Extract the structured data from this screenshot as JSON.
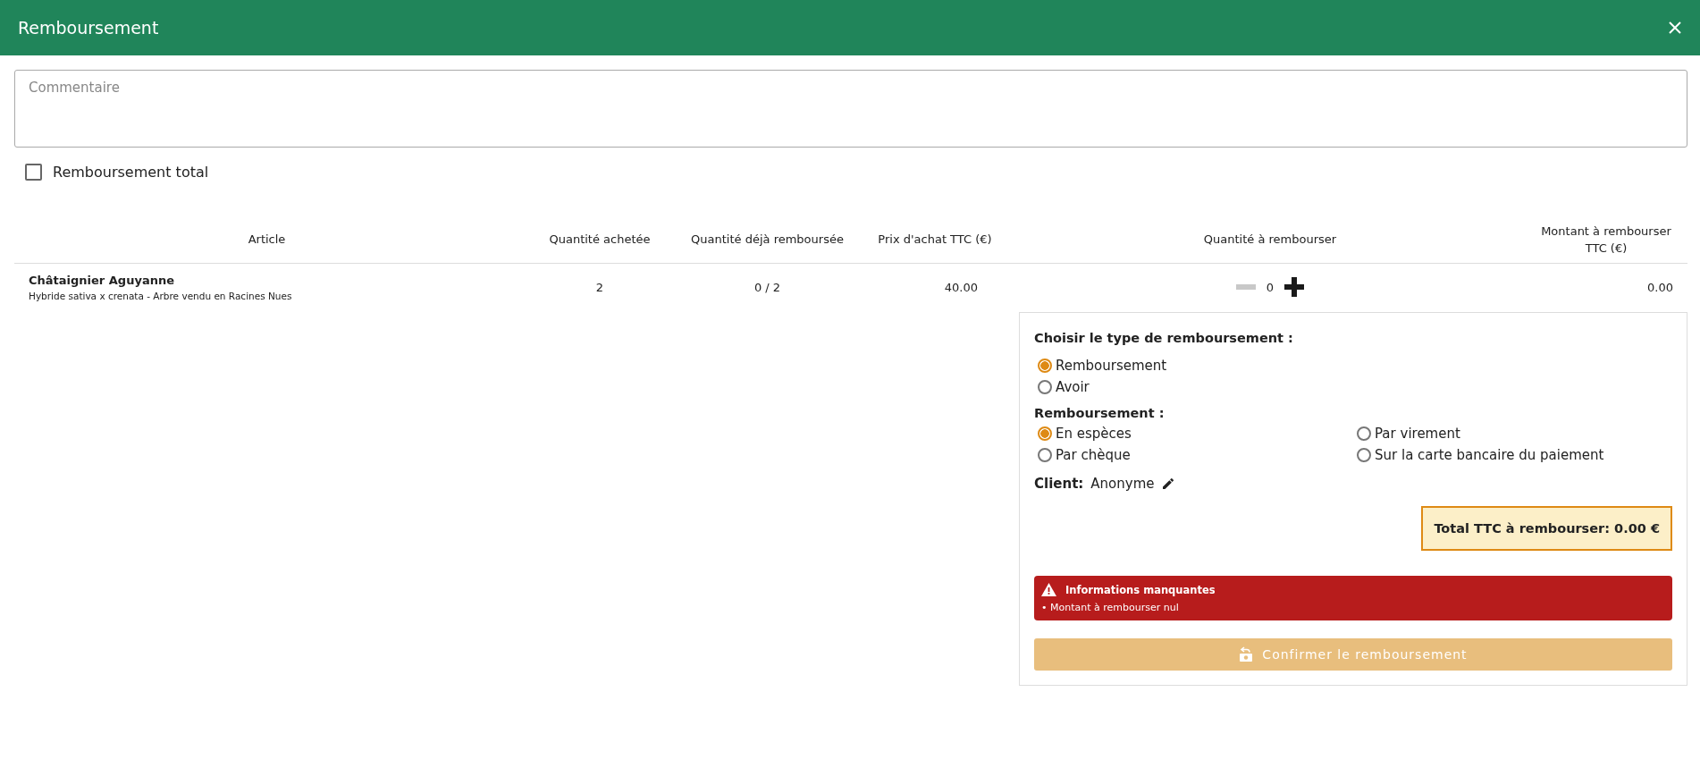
{
  "window": {
    "title": "Remboursement"
  },
  "comment": {
    "placeholder": "Commentaire"
  },
  "full_refund": {
    "label": "Remboursement total",
    "checked": false
  },
  "table": {
    "columns": [
      "Article",
      "Quantité achetée",
      "Quantité déjà remboursée",
      "Prix d'achat TTC (€)",
      "Quantité à rembourser",
      "Montant à rembourser TTC (€)"
    ],
    "rows": [
      {
        "name": "Châtaignier Aguyanne",
        "description": "Hybride sativa x crenata - Arbre vendu en Racines Nues",
        "bought": "2",
        "refunded": "0 / 2",
        "price": "40.00",
        "quantity": "0",
        "decrement_disabled": true,
        "amount": "0.00"
      }
    ]
  },
  "panel": {
    "type_title": "Choisir le type de remboursement :",
    "types": [
      {
        "label": "Remboursement",
        "selected": true
      },
      {
        "label": "Avoir",
        "selected": false
      }
    ],
    "method_title": "Remboursement :",
    "methods": [
      {
        "label": "En espèces",
        "selected": true
      },
      {
        "label": "Par virement",
        "selected": false
      },
      {
        "label": "Par chèque",
        "selected": false
      },
      {
        "label": "Sur la carte bancaire du paiement",
        "selected": false
      }
    ],
    "client_label": "Client:",
    "client_value": "Anonyme",
    "total": "Total TTC à rembourser: 0.00 €",
    "alert": {
      "title": "Informations manquantes",
      "items": [
        "• Montant à rembourser nul"
      ]
    },
    "confirm": {
      "label": "Confirmer le remboursement",
      "disabled": true
    }
  }
}
